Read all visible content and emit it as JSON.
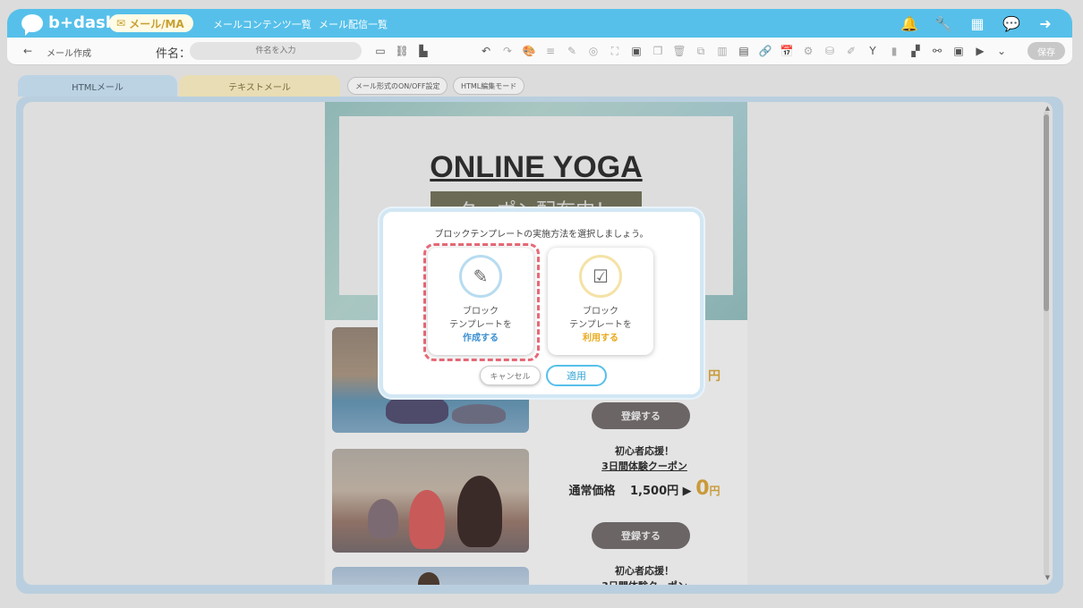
{
  "app": {
    "logo_text": "b+dash",
    "module_pill": "メール/MA",
    "nav": [
      "メールコンテンツ一覧",
      "メール配信一覧"
    ]
  },
  "toolbar": {
    "back_label": "メール作成",
    "subject_label": "件名：",
    "subject_placeholder": "件名を入力",
    "save_label": "保存"
  },
  "tabs": {
    "html": "HTMLメール",
    "text": "テキストメール",
    "format_toggle": "メール形式のON/OFF設定",
    "html_edit": "HTML編集モード"
  },
  "mail": {
    "hero_title": "ONLINE YOGA",
    "hero_banner": "クーポン配布中！",
    "cta_label": "登録する",
    "promo_line1": "初心者応援！",
    "promo_line2": "3日間体験クーポン",
    "price_label": "通常価格",
    "price_regular": "1,500円",
    "price_arrow": "▶",
    "price_new": "0",
    "price_unit": "円",
    "partial_yen": "円"
  },
  "modal": {
    "title": "ブロックテンプレートの実施方法を選択しましょう。",
    "create": {
      "line1": "ブロック",
      "line2": "テンプレートを",
      "line3": "作成する"
    },
    "use": {
      "line1": "ブロック",
      "line2": "テンプレートを",
      "line3": "利用する"
    },
    "cancel_label": "キャンセル",
    "apply_label": "適用"
  },
  "colors": {
    "header": "#56c0ea",
    "accent_blue": "#3a8fd1",
    "accent_yellow": "#e9a91b",
    "selected_outline": "#e86a78"
  }
}
